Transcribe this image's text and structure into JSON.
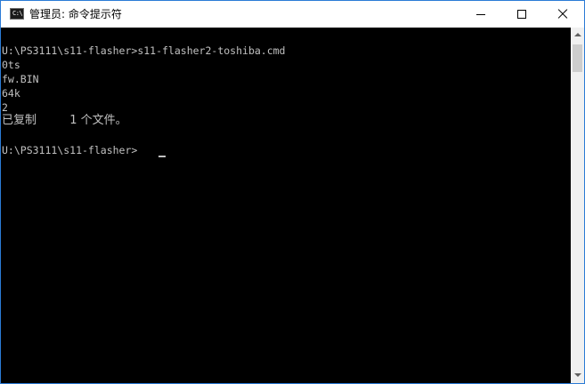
{
  "window": {
    "title": "管理员: 命令提示符",
    "icon_text": "C:\\",
    "icon": "cmd-app-icon",
    "controls": {
      "minimize_icon": "minimize-icon",
      "maximize_icon": "maximize-icon",
      "close_icon": "close-icon"
    }
  },
  "console": {
    "lines": [
      "U:\\PS3111\\s11-flasher>s11-flasher2-toshiba.cmd",
      "0ts",
      "fw.BIN",
      "64k",
      "2",
      "已复制         1 个文件。",
      "",
      "U:\\PS3111\\s11-flasher>"
    ]
  },
  "colors": {
    "console_bg": "#000000",
    "console_text": "#c0c0c0",
    "titlebar_bg": "#ffffff",
    "window_border": "#2b7bd6",
    "scrollbar_bg": "#f0f0f0",
    "scrollbar_thumb": "#cdcdcd"
  }
}
